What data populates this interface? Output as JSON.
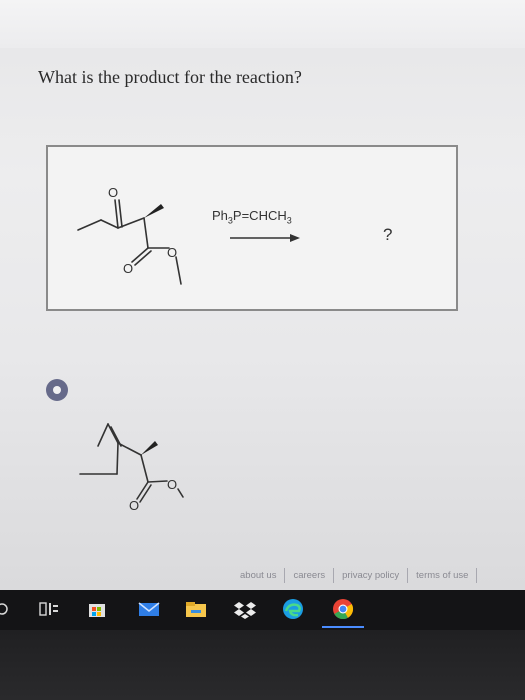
{
  "question": {
    "text": "What is the product for the reaction?"
  },
  "reaction": {
    "reagent_prefix": "Ph",
    "reagent_sub1": "3",
    "reagent_mid": "P=CHCH",
    "reagent_sub2": "3",
    "product_placeholder": "?",
    "reactant_atom_top": "O",
    "reactant_atom_ester_carbonyl": "O",
    "reactant_atom_ester": "O"
  },
  "answer_option": {
    "selected": true,
    "atom_ester_carbonyl": "O",
    "atom_ester": "O"
  },
  "footer": {
    "links": [
      "about us",
      "careers",
      "privacy policy",
      "terms of use"
    ]
  },
  "taskbar": {
    "icons": [
      "task-view-icon",
      "store-icon",
      "mail-icon",
      "file-explorer-icon",
      "dropbox-icon",
      "edge-icon",
      "chrome-icon"
    ],
    "accent": "#4a8cff"
  }
}
